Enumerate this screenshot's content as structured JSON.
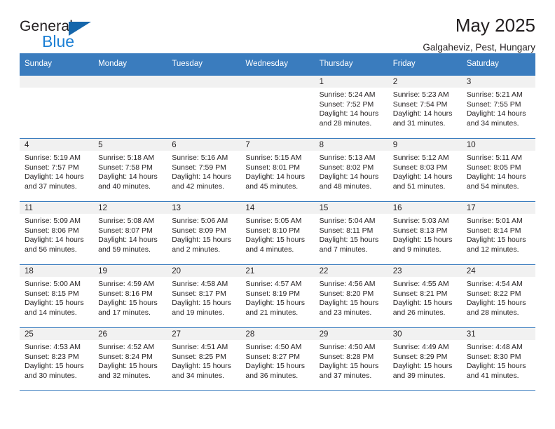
{
  "brand": {
    "name_top": "General",
    "name_bottom": "Blue",
    "accent_color": "#1b7fd4",
    "triangle_color": "#1566ab"
  },
  "header": {
    "title": "May 2025",
    "subtitle": "Galgaheviz, Pest, Hungary"
  },
  "calendar": {
    "header_bg": "#3a7cbe",
    "daynum_band_bg": "#f1f1f1",
    "weekday_headers": [
      "Sunday",
      "Monday",
      "Tuesday",
      "Wednesday",
      "Thursday",
      "Friday",
      "Saturday"
    ],
    "weeks": [
      [
        {
          "day": "",
          "lines": []
        },
        {
          "day": "",
          "lines": []
        },
        {
          "day": "",
          "lines": []
        },
        {
          "day": "",
          "lines": []
        },
        {
          "day": "1",
          "lines": [
            "Sunrise: 5:24 AM",
            "Sunset: 7:52 PM",
            "Daylight: 14 hours",
            "and 28 minutes."
          ]
        },
        {
          "day": "2",
          "lines": [
            "Sunrise: 5:23 AM",
            "Sunset: 7:54 PM",
            "Daylight: 14 hours",
            "and 31 minutes."
          ]
        },
        {
          "day": "3",
          "lines": [
            "Sunrise: 5:21 AM",
            "Sunset: 7:55 PM",
            "Daylight: 14 hours",
            "and 34 minutes."
          ]
        }
      ],
      [
        {
          "day": "4",
          "lines": [
            "Sunrise: 5:19 AM",
            "Sunset: 7:57 PM",
            "Daylight: 14 hours",
            "and 37 minutes."
          ]
        },
        {
          "day": "5",
          "lines": [
            "Sunrise: 5:18 AM",
            "Sunset: 7:58 PM",
            "Daylight: 14 hours",
            "and 40 minutes."
          ]
        },
        {
          "day": "6",
          "lines": [
            "Sunrise: 5:16 AM",
            "Sunset: 7:59 PM",
            "Daylight: 14 hours",
            "and 42 minutes."
          ]
        },
        {
          "day": "7",
          "lines": [
            "Sunrise: 5:15 AM",
            "Sunset: 8:01 PM",
            "Daylight: 14 hours",
            "and 45 minutes."
          ]
        },
        {
          "day": "8",
          "lines": [
            "Sunrise: 5:13 AM",
            "Sunset: 8:02 PM",
            "Daylight: 14 hours",
            "and 48 minutes."
          ]
        },
        {
          "day": "9",
          "lines": [
            "Sunrise: 5:12 AM",
            "Sunset: 8:03 PM",
            "Daylight: 14 hours",
            "and 51 minutes."
          ]
        },
        {
          "day": "10",
          "lines": [
            "Sunrise: 5:11 AM",
            "Sunset: 8:05 PM",
            "Daylight: 14 hours",
            "and 54 minutes."
          ]
        }
      ],
      [
        {
          "day": "11",
          "lines": [
            "Sunrise: 5:09 AM",
            "Sunset: 8:06 PM",
            "Daylight: 14 hours",
            "and 56 minutes."
          ]
        },
        {
          "day": "12",
          "lines": [
            "Sunrise: 5:08 AM",
            "Sunset: 8:07 PM",
            "Daylight: 14 hours",
            "and 59 minutes."
          ]
        },
        {
          "day": "13",
          "lines": [
            "Sunrise: 5:06 AM",
            "Sunset: 8:09 PM",
            "Daylight: 15 hours",
            "and 2 minutes."
          ]
        },
        {
          "day": "14",
          "lines": [
            "Sunrise: 5:05 AM",
            "Sunset: 8:10 PM",
            "Daylight: 15 hours",
            "and 4 minutes."
          ]
        },
        {
          "day": "15",
          "lines": [
            "Sunrise: 5:04 AM",
            "Sunset: 8:11 PM",
            "Daylight: 15 hours",
            "and 7 minutes."
          ]
        },
        {
          "day": "16",
          "lines": [
            "Sunrise: 5:03 AM",
            "Sunset: 8:13 PM",
            "Daylight: 15 hours",
            "and 9 minutes."
          ]
        },
        {
          "day": "17",
          "lines": [
            "Sunrise: 5:01 AM",
            "Sunset: 8:14 PM",
            "Daylight: 15 hours",
            "and 12 minutes."
          ]
        }
      ],
      [
        {
          "day": "18",
          "lines": [
            "Sunrise: 5:00 AM",
            "Sunset: 8:15 PM",
            "Daylight: 15 hours",
            "and 14 minutes."
          ]
        },
        {
          "day": "19",
          "lines": [
            "Sunrise: 4:59 AM",
            "Sunset: 8:16 PM",
            "Daylight: 15 hours",
            "and 17 minutes."
          ]
        },
        {
          "day": "20",
          "lines": [
            "Sunrise: 4:58 AM",
            "Sunset: 8:17 PM",
            "Daylight: 15 hours",
            "and 19 minutes."
          ]
        },
        {
          "day": "21",
          "lines": [
            "Sunrise: 4:57 AM",
            "Sunset: 8:19 PM",
            "Daylight: 15 hours",
            "and 21 minutes."
          ]
        },
        {
          "day": "22",
          "lines": [
            "Sunrise: 4:56 AM",
            "Sunset: 8:20 PM",
            "Daylight: 15 hours",
            "and 23 minutes."
          ]
        },
        {
          "day": "23",
          "lines": [
            "Sunrise: 4:55 AM",
            "Sunset: 8:21 PM",
            "Daylight: 15 hours",
            "and 26 minutes."
          ]
        },
        {
          "day": "24",
          "lines": [
            "Sunrise: 4:54 AM",
            "Sunset: 8:22 PM",
            "Daylight: 15 hours",
            "and 28 minutes."
          ]
        }
      ],
      [
        {
          "day": "25",
          "lines": [
            "Sunrise: 4:53 AM",
            "Sunset: 8:23 PM",
            "Daylight: 15 hours",
            "and 30 minutes."
          ]
        },
        {
          "day": "26",
          "lines": [
            "Sunrise: 4:52 AM",
            "Sunset: 8:24 PM",
            "Daylight: 15 hours",
            "and 32 minutes."
          ]
        },
        {
          "day": "27",
          "lines": [
            "Sunrise: 4:51 AM",
            "Sunset: 8:25 PM",
            "Daylight: 15 hours",
            "and 34 minutes."
          ]
        },
        {
          "day": "28",
          "lines": [
            "Sunrise: 4:50 AM",
            "Sunset: 8:27 PM",
            "Daylight: 15 hours",
            "and 36 minutes."
          ]
        },
        {
          "day": "29",
          "lines": [
            "Sunrise: 4:50 AM",
            "Sunset: 8:28 PM",
            "Daylight: 15 hours",
            "and 37 minutes."
          ]
        },
        {
          "day": "30",
          "lines": [
            "Sunrise: 4:49 AM",
            "Sunset: 8:29 PM",
            "Daylight: 15 hours",
            "and 39 minutes."
          ]
        },
        {
          "day": "31",
          "lines": [
            "Sunrise: 4:48 AM",
            "Sunset: 8:30 PM",
            "Daylight: 15 hours",
            "and 41 minutes."
          ]
        }
      ]
    ]
  }
}
